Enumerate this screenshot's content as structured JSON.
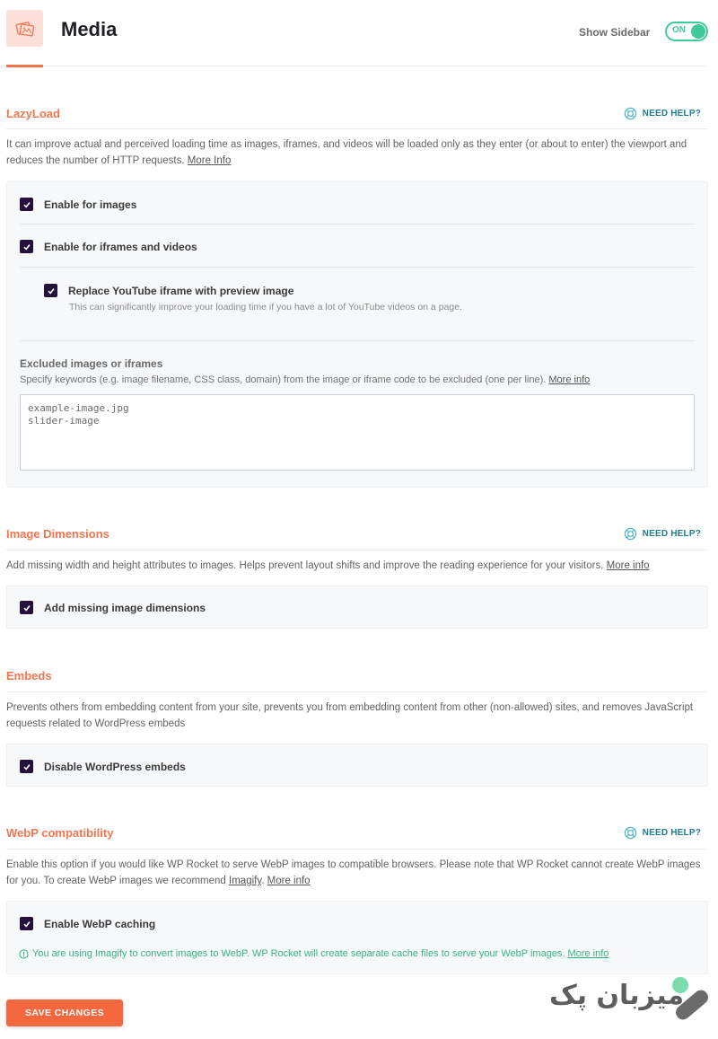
{
  "header": {
    "title": "Media",
    "icon": "media-images-icon",
    "show_sidebar_label": "Show Sidebar",
    "toggle_state": "ON"
  },
  "colors": {
    "accent": "#f5754f",
    "toggle_on": "#40c99a",
    "checkbox": "#24123c",
    "help_link": "#1e7c8e",
    "notice": "#33b37f",
    "save_button": "#f5683f"
  },
  "help_label": "NEED HELP?",
  "lazyload": {
    "title": "LazyLoad",
    "description": "It can improve actual and perceived loading time as images, iframes, and videos will be loaded only as they enter (or about to enter) the viewport and reduces the number of HTTP requests.",
    "more_link": "More Info",
    "options": [
      {
        "label": "Enable for images",
        "checked": true
      },
      {
        "label": "Enable for iframes and videos",
        "checked": true
      }
    ],
    "sub_option": {
      "label": "Replace YouTube iframe with preview image",
      "description": "This can significantly improve your loading time if you have a lot of YouTube videos on a page.",
      "checked": true
    },
    "excluded": {
      "label": "Excluded images or iframes",
      "description": "Specify keywords (e.g. image filename, CSS class, domain) from the image or iframe code to be excluded (one per line).",
      "more_link": "More info",
      "value": "example-image.jpg\nslider-image"
    }
  },
  "image_dimensions": {
    "title": "Image Dimensions",
    "description": "Add missing width and height attributes to images. Helps prevent layout shifts and improve the reading experience for your visitors.",
    "more_link": "More info",
    "option": {
      "label": "Add missing image dimensions",
      "checked": true
    }
  },
  "embeds": {
    "title": "Embeds",
    "description": "Prevents others from embedding content from your site, prevents you from embedding content from other (non-allowed) sites, and removes JavaScript requests related to WordPress embeds",
    "option": {
      "label": "Disable WordPress embeds",
      "checked": true
    }
  },
  "webp": {
    "title": "WebP compatibility",
    "description_1": "Enable this option if you would like WP Rocket to serve WebP images to compatible browsers. Please note that WP Rocket cannot create WebP images for you. To create WebP images we recommend",
    "imagify_link": "Imagify",
    "more_link": "More info",
    "option": {
      "label": "Enable WebP caching",
      "checked": true
    },
    "notice": "You are using Imagify to convert images to WebP. WP Rocket will create separate cache files to serve your WebP images.",
    "notice_link": "More info"
  },
  "save_button": "SAVE CHANGES",
  "watermark": {
    "text": "میزبان پک"
  }
}
